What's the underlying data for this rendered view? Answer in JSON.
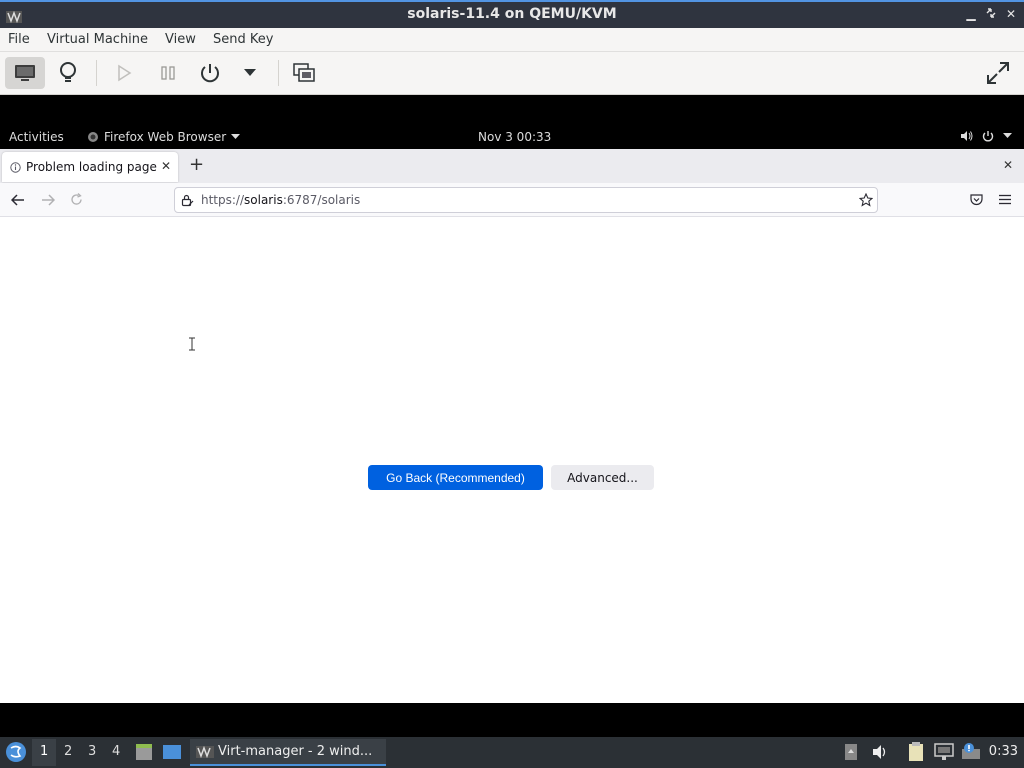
{
  "window": {
    "title": "solaris-11.4 on QEMU/KVM",
    "icon": "virt-manager-icon",
    "controls": {
      "minimize": "▁",
      "restore": "▫",
      "close": "✕"
    }
  },
  "menubar": {
    "items": [
      "File",
      "Virtual Machine",
      "View",
      "Send Key"
    ]
  },
  "toolbar": {
    "buttons": [
      "console-monitor-icon",
      "lightbulb-icon",
      "play-icon",
      "pause-icon",
      "power-icon",
      "dropdown-arrow-icon",
      "snapshots-icon",
      "fullscreen-icon"
    ]
  },
  "gnome": {
    "activities": "Activities",
    "app_menu": "Firefox Web Browser",
    "clock": "Nov 3  00:33"
  },
  "firefox": {
    "tab_title": "Problem loading page",
    "url_scheme": "https://",
    "url_host": "solaris",
    "url_rest": ":6787/solaris",
    "go_back_button": "Go Back (Recommended)",
    "advanced_button": "Advanced..."
  },
  "taskbar": {
    "workspaces": [
      "1",
      "2",
      "3",
      "4"
    ],
    "active_workspace": "1",
    "task_label": "Virt-manager - 2 wind...",
    "clock": "0:33"
  },
  "colors": {
    "accent": "#0061e0",
    "titlebar": "#2f343f",
    "taskbar": "#2b3035"
  }
}
